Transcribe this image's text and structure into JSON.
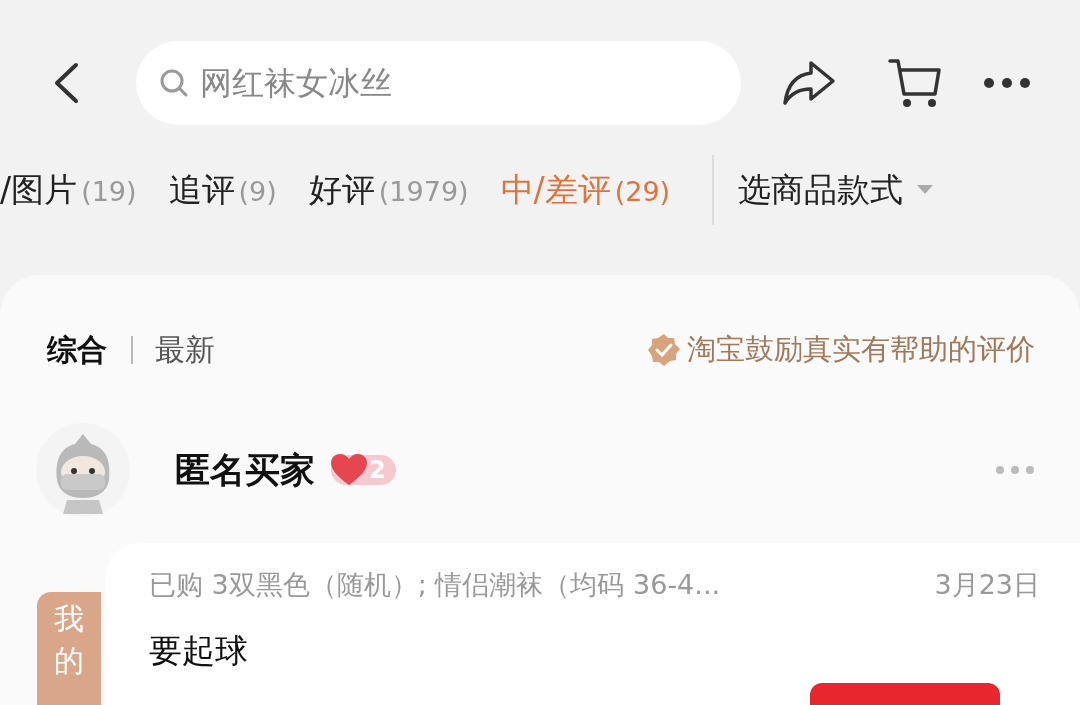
{
  "search": {
    "placeholder": "网红袜女冰丝"
  },
  "filter_tabs": [
    {
      "label": "/图片",
      "count": "(19)",
      "selected": false
    },
    {
      "label": "追评",
      "count": "(9)",
      "selected": false
    },
    {
      "label": "好评",
      "count": "(1979)",
      "selected": false
    },
    {
      "label": "中/差评",
      "count": "(29)",
      "selected": true
    }
  ],
  "style_filter": {
    "label": "选商品款式"
  },
  "sort_options": [
    {
      "label": "综合",
      "selected": true
    },
    {
      "label": "最新",
      "selected": false
    }
  ],
  "notice": "淘宝鼓励真实有帮助的评价",
  "review": {
    "user": "匿名买家",
    "level": "2",
    "purchase": "已购 3双黑色（随机）; 情侣潮袜（均码 36-4...",
    "date": "3月23日",
    "text": "要起球"
  },
  "side_tab": {
    "label": "我的"
  }
}
